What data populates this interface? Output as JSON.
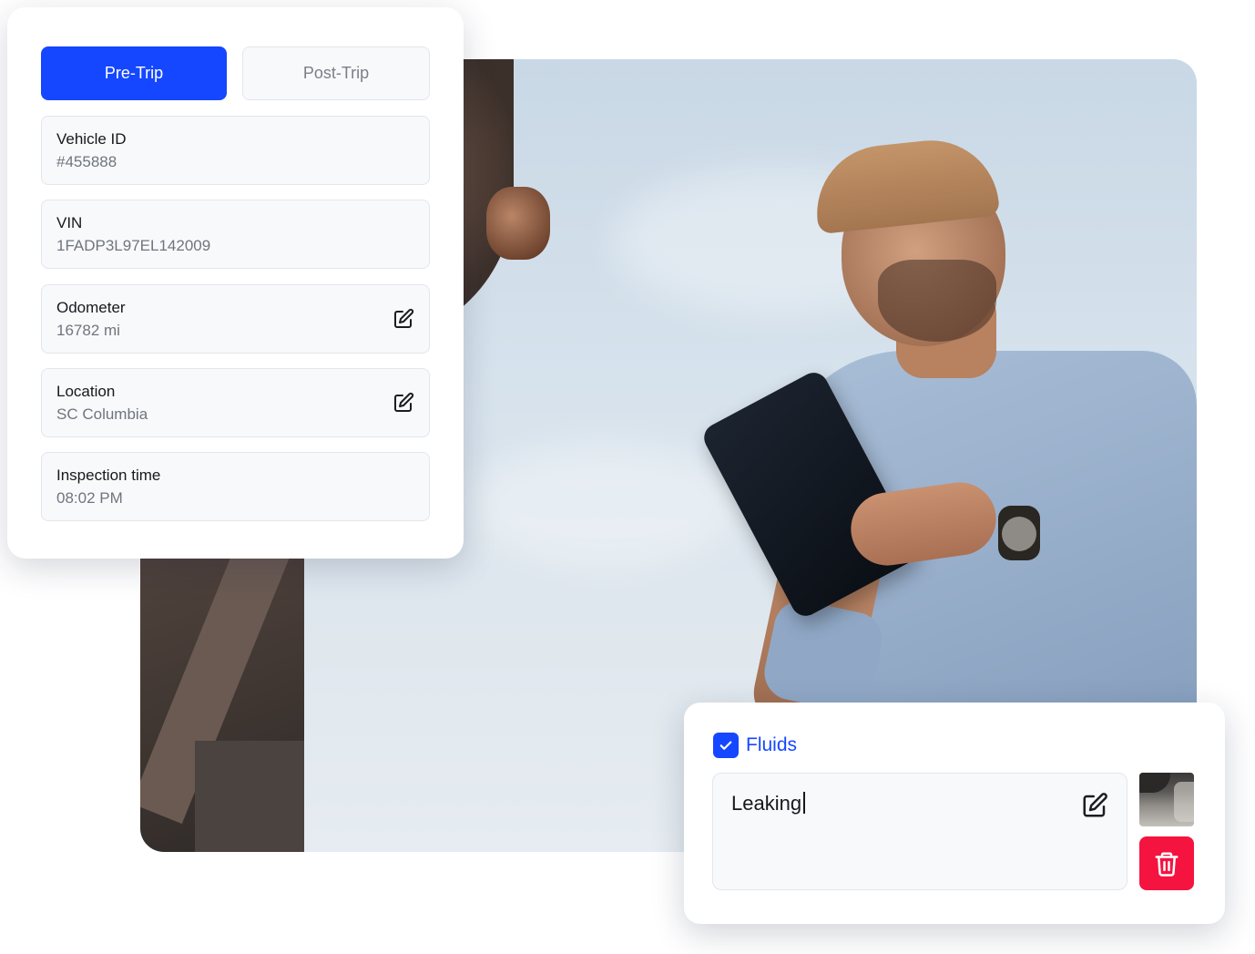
{
  "inspection": {
    "tabs": {
      "pre_trip": "Pre-Trip",
      "post_trip": "Post-Trip"
    },
    "fields": [
      {
        "label": "Vehicle ID",
        "value": "#455888",
        "editable": false
      },
      {
        "label": "VIN",
        "value": "1FADP3L97EL142009",
        "editable": false
      },
      {
        "label": "Odometer",
        "value": "16782 mi",
        "editable": true,
        "icon": "edit-icon"
      },
      {
        "label": "Location",
        "value": "SC Columbia",
        "editable": true,
        "icon": "edit-icon"
      },
      {
        "label": "Inspection time",
        "value": "08:02 PM",
        "editable": false
      }
    ]
  },
  "fluids": {
    "label": "Fluids",
    "checked": true,
    "note": "Leaking",
    "icons": {
      "check": "check-icon",
      "edit": "edit-icon",
      "delete": "trash-icon",
      "photo": "photo-thumbnail"
    }
  },
  "colors": {
    "primary": "#1447ff",
    "danger": "#f5133f",
    "field_bg": "#f8f9fb",
    "field_border": "#e3e6ec",
    "text": "#16181d",
    "muted": "#6f757f"
  }
}
